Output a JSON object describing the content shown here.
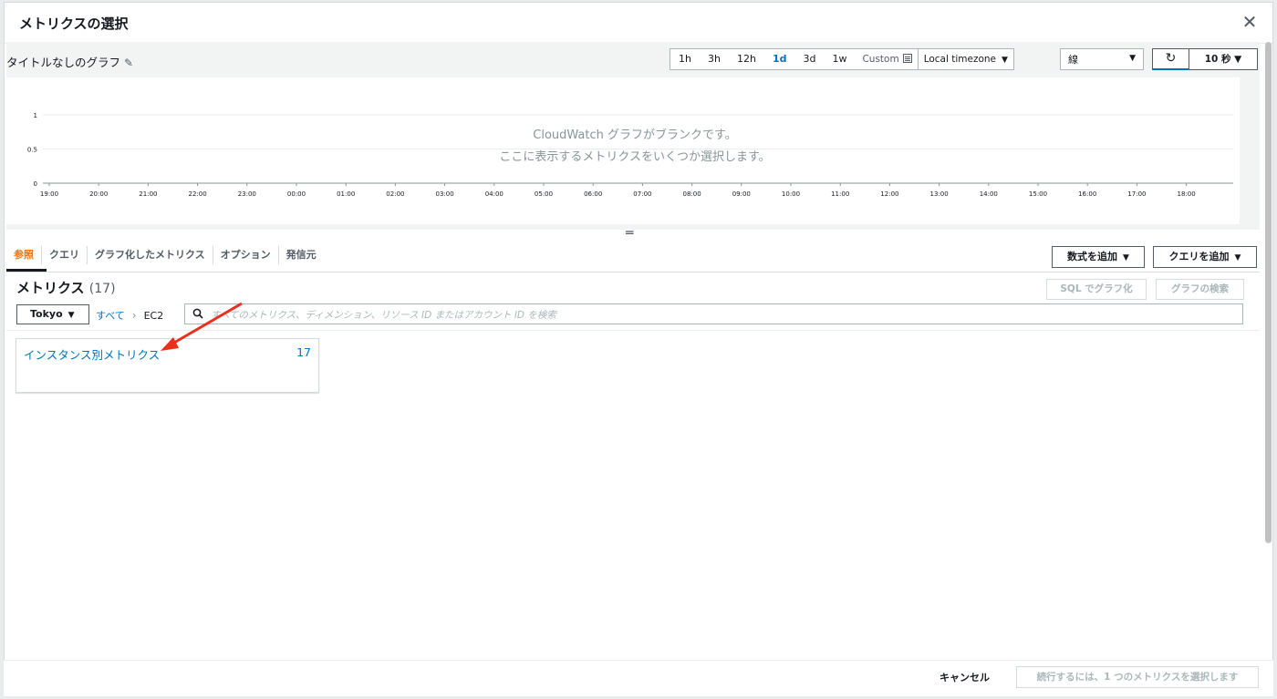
{
  "modal": {
    "title": "メトリクスの選択",
    "close": "✕"
  },
  "graph": {
    "title": "タイトルなしのグラフ",
    "ranges": [
      {
        "label": "1h",
        "active": false
      },
      {
        "label": "3h",
        "active": false
      },
      {
        "label": "12h",
        "active": false
      },
      {
        "label": "1d",
        "active": true
      },
      {
        "label": "3d",
        "active": false
      },
      {
        "label": "1w",
        "active": false
      }
    ],
    "custom_label": "Custom",
    "timezone": "Local timezone",
    "graph_type": "線",
    "interval": "10 秒 ▼",
    "blank_line1": "CloudWatch グラフがブランクです。",
    "blank_line2": "ここに表示するメトリクスをいくつか選択します。"
  },
  "chart_data": {
    "type": "line",
    "x": [
      "19:00",
      "20:00",
      "21:00",
      "22:00",
      "23:00",
      "00:00",
      "01:00",
      "02:00",
      "03:00",
      "04:00",
      "05:00",
      "06:00",
      "07:00",
      "08:00",
      "09:00",
      "10:00",
      "11:00",
      "12:00",
      "13:00",
      "14:00",
      "15:00",
      "16:00",
      "17:00",
      "18:00"
    ],
    "series": [],
    "yticks": [
      "1",
      "0.5",
      "0"
    ],
    "ylim": [
      0,
      1
    ],
    "grid": true
  },
  "tabs": [
    {
      "label": "参照",
      "active": true
    },
    {
      "label": "クエリ",
      "active": false
    },
    {
      "label": "グラフ化したメトリクス",
      "active": false
    },
    {
      "label": "オプション",
      "active": false
    },
    {
      "label": "発信元",
      "active": false
    }
  ],
  "actions": {
    "add_math": "数式を追加",
    "add_query": "クエリを追加"
  },
  "metrics": {
    "title": "メトリクス",
    "count": "(17)",
    "sql_button": "SQL でグラフ化",
    "search_graph_button": "グラフの検索",
    "region": "Tokyo",
    "crumb_all": "すべて",
    "crumb_current": "EC2",
    "search_placeholder": "すべてのメトリクス、ディメンション、リソース ID またはアカウント ID を検索",
    "cards": [
      {
        "label": "インスタンス別メトリクス",
        "count": "17"
      }
    ]
  },
  "footer": {
    "cancel": "キャンセル",
    "continue": "続行するには、1 つのメトリクスを選択します"
  },
  "colors": {
    "accent": "#0073bb",
    "active_tab": "#ec7211",
    "arrow": "#e8301c"
  }
}
